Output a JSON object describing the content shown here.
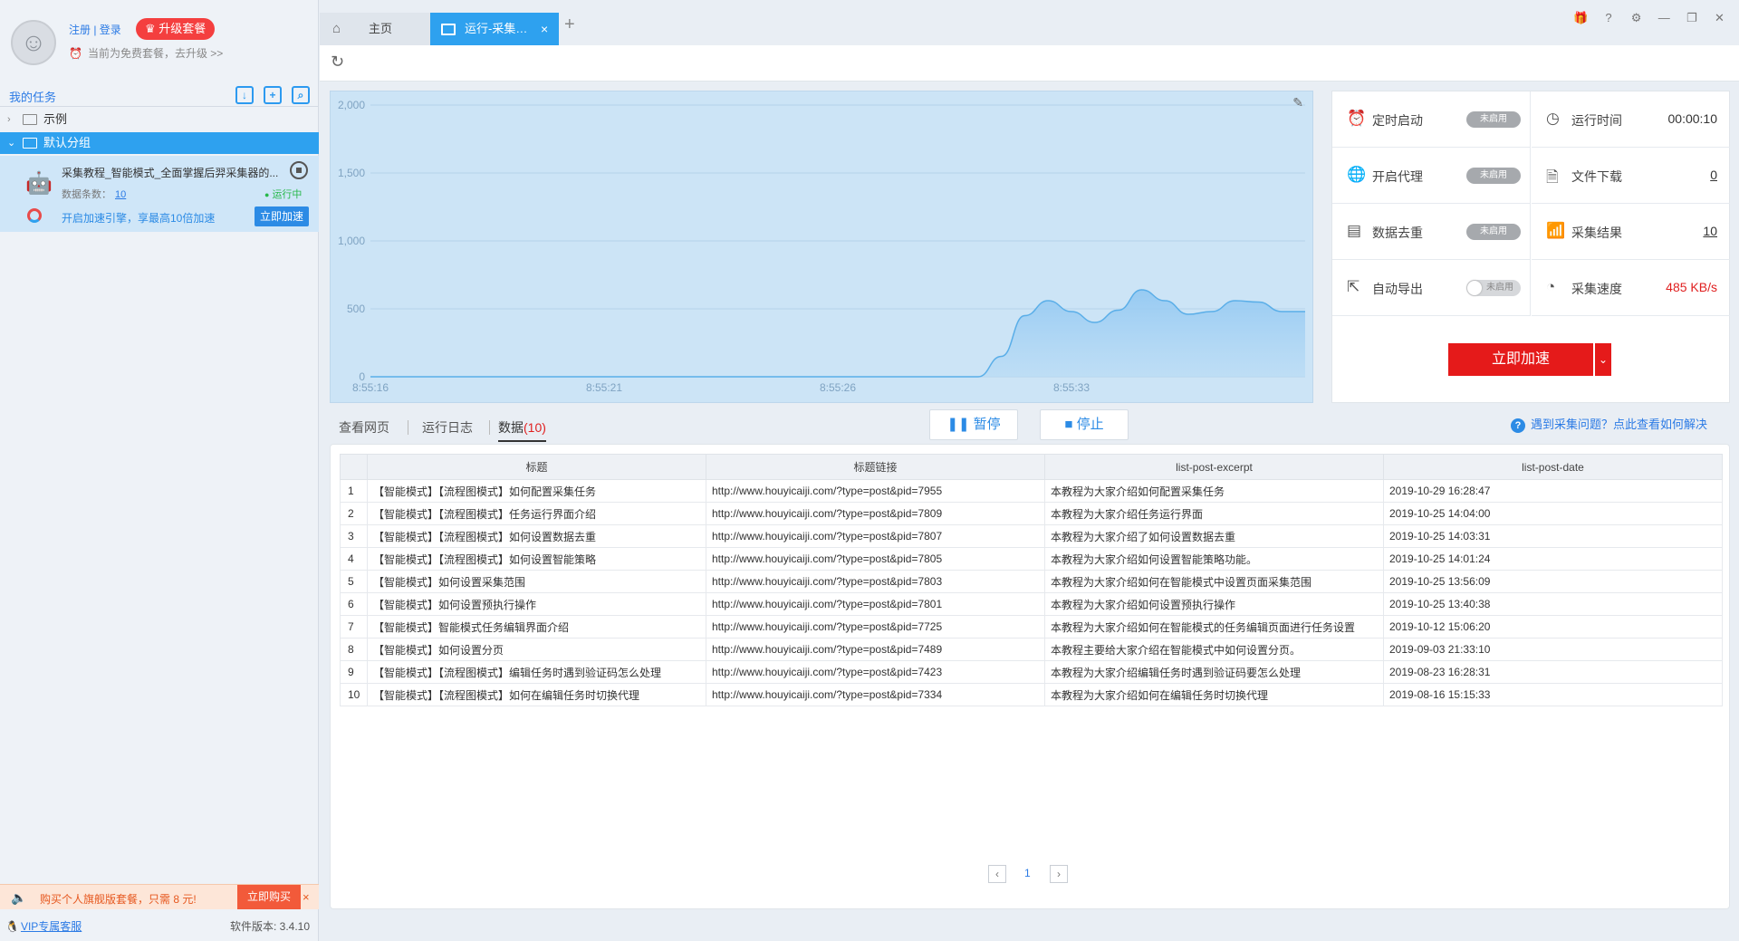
{
  "user": {
    "login_link": "注册 | 登录",
    "upgrade_label": "升级套餐",
    "plan_text": "当前为免费套餐，去升级 >>"
  },
  "sidebar": {
    "title": "我的任务",
    "tree": [
      {
        "label": "示例",
        "expanded": false
      },
      {
        "label": "默认分组",
        "expanded": true
      }
    ],
    "task": {
      "name": "采集教程_智能模式_全面掌握后羿采集器的...",
      "data_count_label": "数据条数：",
      "data_count": "10",
      "status": "运行中",
      "accel_hint": "开启加速引擎，享最高10倍加速",
      "accel_button": "立即加速"
    },
    "promo": {
      "text": "购买个人旗舰版套餐，只需 8 元!",
      "buy_label": "立即购买",
      "close": "×"
    },
    "footer": {
      "vip_label": "VIP专属客服",
      "version": "软件版本: 3.4.10"
    }
  },
  "tabs": [
    {
      "label": "主页"
    },
    {
      "label": "运行-采集教程_智能模式_全面掌握后羿采集器的...",
      "close": "×"
    }
  ],
  "chart_data": {
    "type": "area",
    "x_ticks": [
      "8:55:16",
      "8:55:21",
      "8:55:26",
      "8:55:33"
    ],
    "y_ticks": [
      "2,000",
      "1,500",
      "1,000",
      "500",
      "0"
    ],
    "ylim": [
      0,
      2000
    ],
    "xlim": [
      0,
      40
    ],
    "grid": true,
    "color": "#94c9f2",
    "series": [
      {
        "x": [
          0,
          26,
          27,
          28,
          29,
          30,
          31,
          32,
          33,
          34,
          35,
          36,
          37,
          38,
          39,
          40
        ],
        "values": [
          0,
          0,
          150,
          450,
          560,
          480,
          400,
          490,
          640,
          560,
          460,
          480,
          560,
          550,
          480,
          480
        ]
      }
    ]
  },
  "stats": {
    "scheduled": {
      "name": "定时启动",
      "state": "未启用"
    },
    "runtime": {
      "name": "运行时间",
      "value": "00:00:10"
    },
    "proxy": {
      "name": "开启代理",
      "state": "未启用"
    },
    "download": {
      "name": "文件下载",
      "value": "0"
    },
    "dedupe": {
      "name": "数据去重",
      "state": "未启用"
    },
    "results": {
      "name": "采集结果",
      "value": "10"
    },
    "export": {
      "name": "自动导出",
      "state": "未启用"
    },
    "speed": {
      "name": "采集速度",
      "value": "485 KB/s"
    },
    "accel_button": "立即加速"
  },
  "subtabs": [
    {
      "label": "查看网页"
    },
    {
      "label": "运行日志"
    },
    {
      "label": "数据",
      "count": "(10)"
    }
  ],
  "controls": {
    "pause_label": "暂停",
    "stop_label": "停止",
    "help_text": "遇到采集问题？点此查看如何解决"
  },
  "table": {
    "headers": [
      "标题",
      "标题链接",
      "list-post-excerpt",
      "list-post-date"
    ],
    "rows": [
      {
        "idx": "1",
        "title": "【智能模式】【流程图模式】如何配置采集任务",
        "link": "http://www.houyicaiji.com/?type=post&pid=7955",
        "excerpt": "本教程为大家介绍如何配置采集任务",
        "date": "2019-10-29 16:28:47"
      },
      {
        "idx": "2",
        "title": "【智能模式】【流程图模式】任务运行界面介绍",
        "link": "http://www.houyicaiji.com/?type=post&pid=7809",
        "excerpt": "本教程为大家介绍任务运行界面",
        "date": "2019-10-25 14:04:00"
      },
      {
        "idx": "3",
        "title": "【智能模式】【流程图模式】如何设置数据去重",
        "link": "http://www.houyicaiji.com/?type=post&pid=7807",
        "excerpt": "本教程为大家介绍了如何设置数据去重",
        "date": "2019-10-25 14:03:31"
      },
      {
        "idx": "4",
        "title": "【智能模式】【流程图模式】如何设置智能策略",
        "link": "http://www.houyicaiji.com/?type=post&pid=7805",
        "excerpt": "本教程为大家介绍如何设置智能策略功能。",
        "date": "2019-10-25 14:01:24"
      },
      {
        "idx": "5",
        "title": "【智能模式】如何设置采集范围",
        "link": "http://www.houyicaiji.com/?type=post&pid=7803",
        "excerpt": "本教程为大家介绍如何在智能模式中设置页面采集范围",
        "date": "2019-10-25 13:56:09"
      },
      {
        "idx": "6",
        "title": "【智能模式】如何设置预执行操作",
        "link": "http://www.houyicaiji.com/?type=post&pid=7801",
        "excerpt": "本教程为大家介绍如何设置预执行操作",
        "date": "2019-10-25 13:40:38"
      },
      {
        "idx": "7",
        "title": "【智能模式】智能模式任务编辑界面介绍",
        "link": "http://www.houyicaiji.com/?type=post&pid=7725",
        "excerpt": "本教程为大家介绍如何在智能模式的任务编辑页面进行任务设置",
        "date": "2019-10-12 15:06:20"
      },
      {
        "idx": "8",
        "title": "【智能模式】如何设置分页",
        "link": "http://www.houyicaiji.com/?type=post&pid=7489",
        "excerpt": "本教程主要给大家介绍在智能模式中如何设置分页。",
        "date": "2019-09-03 21:33:10"
      },
      {
        "idx": "9",
        "title": "【智能模式】【流程图模式】编辑任务时遇到验证码怎么处理",
        "link": "http://www.houyicaiji.com/?type=post&pid=7423",
        "excerpt": "本教程为大家介绍编辑任务时遇到验证码要怎么处理",
        "date": "2019-08-23 16:28:31"
      },
      {
        "idx": "10",
        "title": "【智能模式】【流程图模式】如何在编辑任务时切换代理",
        "link": "http://www.houyicaiji.com/?type=post&pid=7334",
        "excerpt": "本教程为大家介绍如何在编辑任务时切换代理",
        "date": "2019-08-16 15:15:33"
      }
    ]
  },
  "pager": {
    "page": "1"
  }
}
